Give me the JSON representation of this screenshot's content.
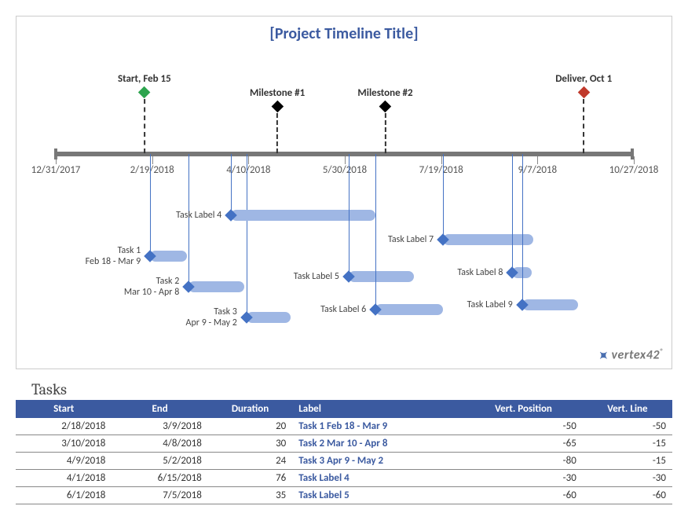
{
  "title": "[Project Timeline Title]",
  "section_title": "Tasks",
  "logo": "vertex42",
  "columns": {
    "start": "Start",
    "end": "End",
    "duration": "Duration",
    "label": "Label",
    "vpos": "Vert. Position",
    "vline": "Vert. Line"
  },
  "chart_data": {
    "type": "timeline",
    "title": "[Project Timeline Title]",
    "x_axis": {
      "min": "12/31/2017",
      "max": "10/27/2018",
      "ticks": [
        "12/31/2017",
        "2/19/2018",
        "4/10/2018",
        "5/30/2018",
        "7/19/2018",
        "9/7/2018",
        "10/27/2018"
      ]
    },
    "milestones": [
      {
        "label": "Start, Feb 15",
        "date": "2/15/2018",
        "color": "#2da44e"
      },
      {
        "label": "Milestone #1",
        "date": "4/25/2018",
        "color": "#000000"
      },
      {
        "label": "Milestone #2",
        "date": "6/20/2018",
        "color": "#000000"
      },
      {
        "label": "Deliver, Oct 1",
        "date": "10/1/2018",
        "color": "#c0392b"
      }
    ],
    "tasks": [
      {
        "start": "2/18/2018",
        "end": "3/9/2018",
        "duration": 20,
        "label": "Task 1  Feb 18 - Mar 9",
        "short": "Task 1\nFeb 18 - Mar 9",
        "vpos": -50,
        "vline": -50
      },
      {
        "start": "3/10/2018",
        "end": "4/8/2018",
        "duration": 30,
        "label": "Task 2  Mar 10 - Apr 8",
        "short": "Task 2\nMar 10 - Apr 8",
        "vpos": -65,
        "vline": -15
      },
      {
        "start": "4/9/2018",
        "end": "5/2/2018",
        "duration": 24,
        "label": "Task 3  Apr 9 - May 2",
        "short": "Task 3\nApr 9 - May 2",
        "vpos": -80,
        "vline": -15
      },
      {
        "start": "4/1/2018",
        "end": "6/15/2018",
        "duration": 76,
        "label": "Task Label 4",
        "short": "Task Label 4",
        "vpos": -30,
        "vline": -30
      },
      {
        "start": "6/1/2018",
        "end": "7/5/2018",
        "duration": 35,
        "label": "Task Label 5",
        "short": "Task Label 5",
        "vpos": -60,
        "vline": -60
      },
      {
        "start": "6/15/2018",
        "end": "7/20/2018",
        "duration": 36,
        "label": "Task Label 6",
        "short": "Task Label 6",
        "vpos": -76,
        "vline": -16
      },
      {
        "start": "7/20/2018",
        "end": "9/5/2018",
        "duration": 48,
        "label": "Task Label 7",
        "short": "Task Label 7",
        "vpos": -42,
        "vline": -42
      },
      {
        "start": "8/25/2018",
        "end": "9/4/2018",
        "duration": 11,
        "label": "Task Label 8",
        "short": "Task Label 8",
        "vpos": -58,
        "vline": -16
      },
      {
        "start": "8/30/2018",
        "end": "9/28/2018",
        "duration": 30,
        "label": "Task Label 9",
        "short": "Task Label 9",
        "vpos": -74,
        "vline": -16
      }
    ],
    "table": [
      {
        "start": "2/18/2018",
        "end": "3/9/2018",
        "duration": 20,
        "label": "Task 1  Feb 18 - Mar 9",
        "vpos": -50,
        "vline": -50
      },
      {
        "start": "3/10/2018",
        "end": "4/8/2018",
        "duration": 30,
        "label": "Task 2  Mar 10 - Apr 8",
        "vpos": -65,
        "vline": -15
      },
      {
        "start": "4/9/2018",
        "end": "5/2/2018",
        "duration": 24,
        "label": "Task 3  Apr 9 - May 2",
        "vpos": -80,
        "vline": -15
      },
      {
        "start": "4/1/2018",
        "end": "6/15/2018",
        "duration": 76,
        "label": "Task Label 4",
        "vpos": -30,
        "vline": -30
      },
      {
        "start": "6/1/2018",
        "end": "7/5/2018",
        "duration": 35,
        "label": "Task Label 5",
        "vpos": -60,
        "vline": -60
      }
    ]
  }
}
